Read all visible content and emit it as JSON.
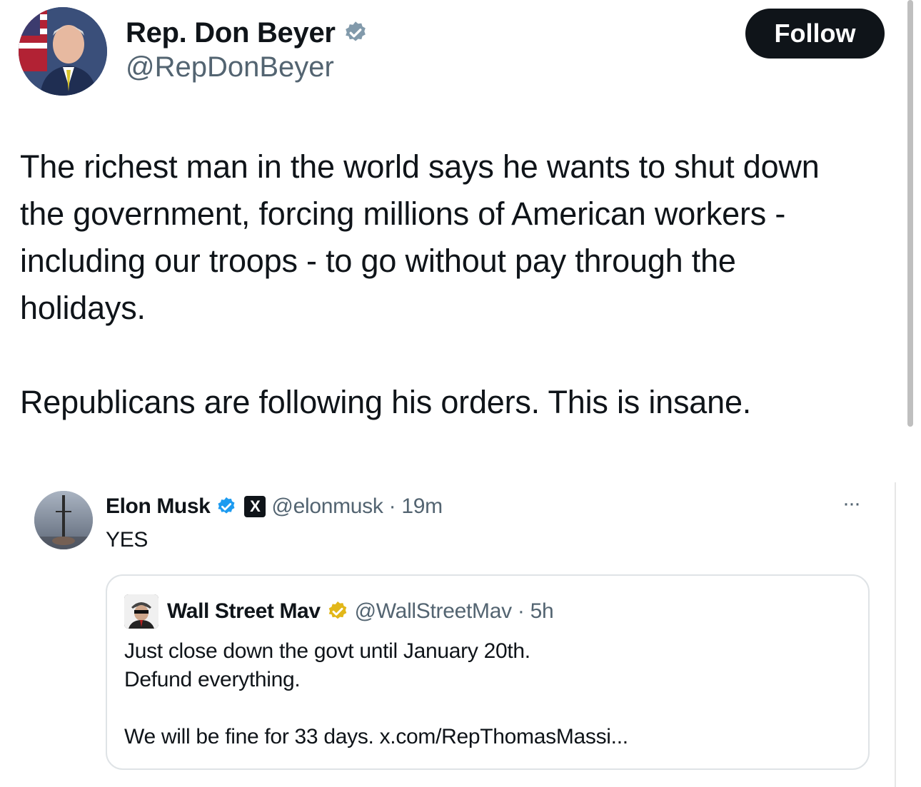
{
  "author": {
    "display_name": "Rep. Don Beyer",
    "handle": "@RepDonBeyer",
    "verified": "gray",
    "avatar_icon": "profile-photo-icon"
  },
  "follow_button": {
    "label": "Follow"
  },
  "tweet": {
    "lines": [
      "The richest man in the world says he wants to shut down",
      "the government, forcing millions of American workers -",
      "including our troops - to go without pay through the",
      "holidays.",
      "Republicans are following his orders. This is insane."
    ]
  },
  "embedded_reply": {
    "display_name": "Elon Musk",
    "x_badge": "X",
    "handle_time": "@elonmusk · 19m",
    "text": "YES",
    "more_glyph": "···",
    "quote": {
      "display_name": "Wall Street Mav",
      "handle_time": "@WallStreetMav · 5h",
      "lines": [
        "Just close down the govt until January 20th.",
        "Defund everything.",
        "We will be fine for 33 days. x.com/RepThomasMassi..."
      ]
    }
  },
  "colors": {
    "text": "#0f1419",
    "muted": "#536471",
    "follow_bg": "#0f1419",
    "verified_blue": "#1d9bf0",
    "verified_gold": "#e2b719",
    "verified_gray": "#829aab"
  }
}
